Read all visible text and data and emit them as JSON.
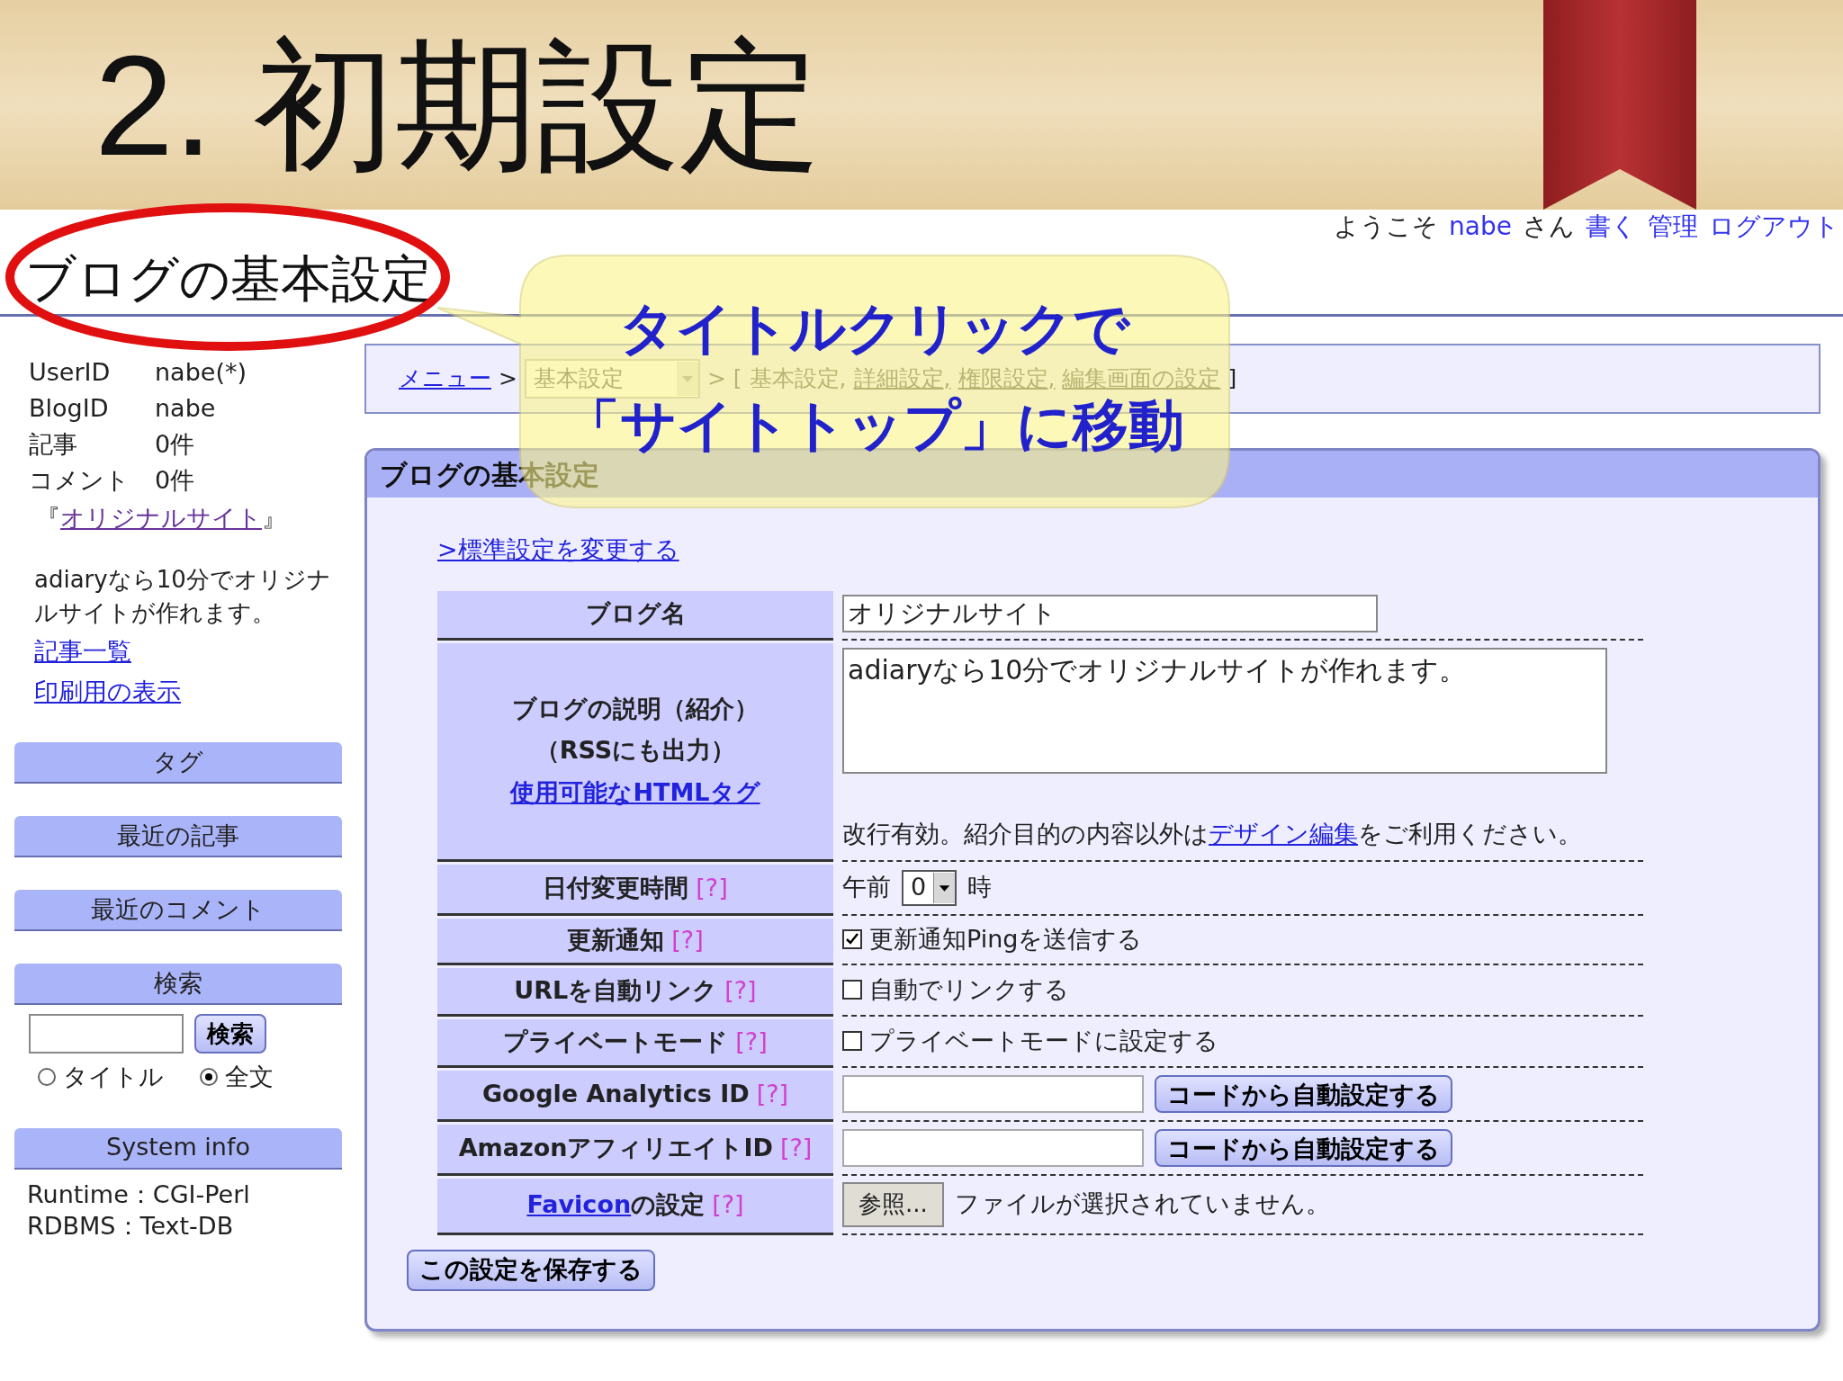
{
  "slide": {
    "title": "2. 初期設定"
  },
  "topbar": {
    "welcome": "ようこそ",
    "user": "nabe",
    "suffix": "さん",
    "links": [
      "書く",
      "管理",
      "ログアウト"
    ]
  },
  "blog_title": "ブログの基本設定",
  "callout": {
    "lines": [
      "タイトルクリックで",
      "「サイトトップ」に移動"
    ]
  },
  "sidebar": {
    "profile": [
      {
        "label": "UserID",
        "value": "nabe(*)"
      },
      {
        "label": "BlogID",
        "value": "nabe"
      },
      {
        "label": "記事",
        "value": "0件"
      },
      {
        "label": "コメント",
        "value": "0件"
      }
    ],
    "site": {
      "open": "『",
      "link": "オリジナルサイト",
      "close": "』"
    },
    "description": "adiaryなら10分でオリジナルサイトが作れます。",
    "links": [
      "記事一覧",
      "印刷用の表示"
    ],
    "sections": [
      "タグ",
      "最近の記事",
      "最近のコメント"
    ],
    "search": {
      "heading": "検索",
      "button": "検索",
      "options": [
        {
          "label": "タイトル",
          "selected": false
        },
        {
          "label": "全文",
          "selected": true
        }
      ]
    },
    "system_info": {
      "heading": "System info",
      "lines": [
        "Runtime：CGI-Perl",
        "RDBMS：Text-DB"
      ]
    }
  },
  "breadcrumb": {
    "menu": "メニュー",
    "sep": ">",
    "select": "基本設定",
    "open": "> [",
    "items": [
      {
        "label": "基本設定",
        "link": false
      },
      {
        "label": "詳細設定",
        "link": true
      },
      {
        "label": "権限設定",
        "link": true
      },
      {
        "label": "編集画面の設定",
        "link": true
      }
    ],
    "comma": ",",
    "close": "]"
  },
  "panel": {
    "title": "ブログの基本設定",
    "change_link": ">標準設定を変更する",
    "rows": [
      {
        "kind": "text",
        "label": "ブログ名",
        "value": "オリジナルサイト"
      },
      {
        "kind": "textarea",
        "label_lines": [
          "ブログの説明（紹介）",
          "（RSSにも出力）"
        ],
        "label_link": "使用可能なHTMLタグ",
        "value": "adiaryなら10分でオリジナルサイトが作れます。",
        "note_before": "改行有効。紹介目的の内容以外は",
        "note_link": "デザイン編集",
        "note_after": "をご利用ください。"
      },
      {
        "kind": "select",
        "label": "日付変更時間",
        "help": "[?]",
        "prefix": "午前",
        "value": "0",
        "suffix": "時"
      },
      {
        "kind": "checkbox",
        "label": "更新通知",
        "help": "[?]",
        "text": "更新通知Pingを送信する",
        "checked": true
      },
      {
        "kind": "checkbox",
        "label": "URLを自動リンク",
        "help": "[?]",
        "text": "自動でリンクする",
        "checked": false
      },
      {
        "kind": "checkbox",
        "label": "プライベートモード",
        "help": "[?]",
        "text": "プライベートモードに設定する",
        "checked": false
      },
      {
        "kind": "id",
        "label": "Google Analytics ID",
        "help": "[?]",
        "button": "コードから自動設定する"
      },
      {
        "kind": "id",
        "label": "AmazonアフィリエイトID",
        "help": "[?]",
        "button": "コードから自動設定する"
      },
      {
        "kind": "file",
        "label_link": "Favicon",
        "label": "の設定",
        "help": "[?]",
        "button": "参照...",
        "status": "ファイルが選択されていません。"
      }
    ],
    "save_button": "この設定を保存する"
  }
}
